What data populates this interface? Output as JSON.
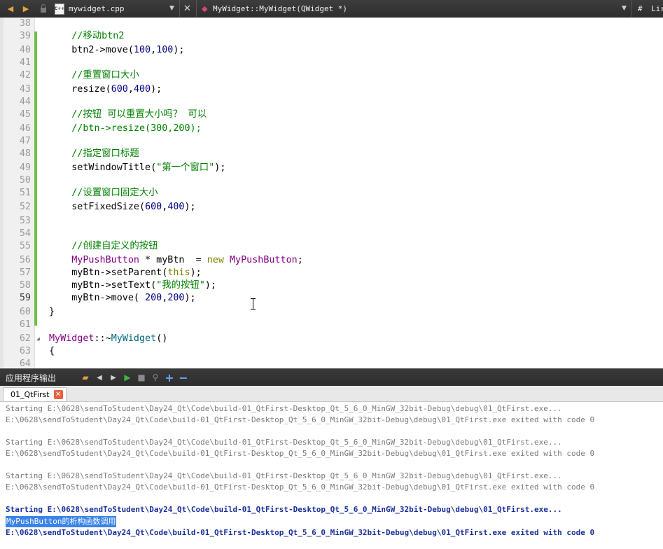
{
  "toolbar": {
    "file_name": "mywidget.cpp",
    "file_icon_text": "C++",
    "function_scope": "MyWidget::MyWidget(QWidget *)",
    "hash_label": "#",
    "lines_label": "Lir"
  },
  "editor": {
    "lines": [
      {
        "num": "38",
        "parts": []
      },
      {
        "num": "39",
        "parts": [
          {
            "t": "    "
          },
          {
            "t": "//移动btn2",
            "c": "com"
          }
        ]
      },
      {
        "num": "40",
        "parts": [
          {
            "t": "    btn2->move("
          },
          {
            "t": "100",
            "c": "num"
          },
          {
            "t": ","
          },
          {
            "t": "100",
            "c": "num"
          },
          {
            "t": ");"
          }
        ]
      },
      {
        "num": "41",
        "parts": []
      },
      {
        "num": "42",
        "parts": [
          {
            "t": "    "
          },
          {
            "t": "//重置窗口大小",
            "c": "com"
          }
        ]
      },
      {
        "num": "43",
        "parts": [
          {
            "t": "    resize("
          },
          {
            "t": "600",
            "c": "num"
          },
          {
            "t": ","
          },
          {
            "t": "400",
            "c": "num"
          },
          {
            "t": ");"
          }
        ]
      },
      {
        "num": "44",
        "parts": []
      },
      {
        "num": "45",
        "parts": [
          {
            "t": "    "
          },
          {
            "t": "//按钮 可以重置大小吗？ 可以",
            "c": "com"
          }
        ]
      },
      {
        "num": "46",
        "parts": [
          {
            "t": "    "
          },
          {
            "t": "//btn->resize(300,200);",
            "c": "com"
          }
        ]
      },
      {
        "num": "47",
        "parts": []
      },
      {
        "num": "48",
        "parts": [
          {
            "t": "    "
          },
          {
            "t": "//指定窗口标题",
            "c": "com"
          }
        ]
      },
      {
        "num": "49",
        "parts": [
          {
            "t": "    setWindowTitle("
          },
          {
            "t": "\"第一个窗口\"",
            "c": "str"
          },
          {
            "t": ");"
          }
        ]
      },
      {
        "num": "50",
        "parts": []
      },
      {
        "num": "51",
        "parts": [
          {
            "t": "    "
          },
          {
            "t": "//设置窗口固定大小",
            "c": "com"
          }
        ]
      },
      {
        "num": "52",
        "parts": [
          {
            "t": "    setFixedSize("
          },
          {
            "t": "600",
            "c": "num"
          },
          {
            "t": ","
          },
          {
            "t": "400",
            "c": "num"
          },
          {
            "t": ");"
          }
        ]
      },
      {
        "num": "53",
        "parts": []
      },
      {
        "num": "54",
        "parts": []
      },
      {
        "num": "55",
        "parts": [
          {
            "t": "    "
          },
          {
            "t": "//创建自定义的按钮",
            "c": "com"
          }
        ]
      },
      {
        "num": "56",
        "parts": [
          {
            "t": "    "
          },
          {
            "t": "MyPushButton",
            "c": "type"
          },
          {
            "t": " * myBtn  = "
          },
          {
            "t": "new",
            "c": "kw"
          },
          {
            "t": " "
          },
          {
            "t": "MyPushButton",
            "c": "type"
          },
          {
            "t": ";"
          }
        ]
      },
      {
        "num": "57",
        "parts": [
          {
            "t": "    myBtn->setParent("
          },
          {
            "t": "this",
            "c": "kw"
          },
          {
            "t": ");"
          }
        ]
      },
      {
        "num": "58",
        "parts": [
          {
            "t": "    myBtn->setText("
          },
          {
            "t": "\"我的按钮\"",
            "c": "str"
          },
          {
            "t": ");"
          }
        ]
      },
      {
        "num": "59",
        "parts": [
          {
            "t": "    myBtn->move( "
          },
          {
            "t": "200",
            "c": "num"
          },
          {
            "t": ","
          },
          {
            "t": "200",
            "c": "num"
          },
          {
            "t": ");"
          }
        ]
      },
      {
        "num": "60",
        "parts": [
          {
            "t": "}"
          }
        ]
      },
      {
        "num": "61",
        "parts": []
      },
      {
        "num": "62",
        "parts": [
          {
            "t": "MyWidget",
            "c": "type"
          },
          {
            "t": "::~"
          },
          {
            "t": "MyWidget",
            "c": "fn"
          },
          {
            "t": "()"
          }
        ],
        "fold": true
      },
      {
        "num": "63",
        "parts": [
          {
            "t": "{"
          }
        ]
      },
      {
        "num": "64",
        "parts": []
      }
    ],
    "current_line": "59"
  },
  "output_pane": {
    "title": "应用程序输出",
    "tab_label": "01_QtFirst",
    "log": [
      {
        "text": "Starting E:\\0628\\sendToStudent\\Day24_Qt\\Code\\build-01_QtFirst-Desktop_Qt_5_6_0_MinGW_32bit-Debug\\debug\\01_QtFirst.exe...",
        "style": "grey"
      },
      {
        "text": "E:\\0628\\sendToStudent\\Day24_Qt\\Code\\build-01_QtFirst-Desktop_Qt_5_6_0_MinGW_32bit-Debug\\debug\\01_QtFirst.exe exited with code 0",
        "style": "grey"
      },
      {
        "text": "",
        "style": "grey"
      },
      {
        "text": "Starting E:\\0628\\sendToStudent\\Day24_Qt\\Code\\build-01_QtFirst-Desktop_Qt_5_6_0_MinGW_32bit-Debug\\debug\\01_QtFirst.exe...",
        "style": "grey"
      },
      {
        "text": "E:\\0628\\sendToStudent\\Day24_Qt\\Code\\build-01_QtFirst-Desktop_Qt_5_6_0_MinGW_32bit-Debug\\debug\\01_QtFirst.exe exited with code 0",
        "style": "grey"
      },
      {
        "text": "",
        "style": "grey"
      },
      {
        "text": "Starting E:\\0628\\sendToStudent\\Day24_Qt\\Code\\build-01_QtFirst-Desktop_Qt_5_6_0_MinGW_32bit-Debug\\debug\\01_QtFirst.exe...",
        "style": "grey"
      },
      {
        "text": "E:\\0628\\sendToStudent\\Day24_Qt\\Code\\build-01_QtFirst-Desktop_Qt_5_6_0_MinGW_32bit-Debug\\debug\\01_QtFirst.exe exited with code 0",
        "style": "grey"
      },
      {
        "text": "",
        "style": "grey"
      },
      {
        "text": "Starting E:\\0628\\sendToStudent\\Day24_Qt\\Code\\build-01_QtFirst-Desktop_Qt_5_6_0_MinGW_32bit-Debug\\debug\\01_QtFirst.exe...",
        "style": "blue"
      },
      {
        "text": "MyPushButton的析构函数调用",
        "style": "sel"
      },
      {
        "text": "E:\\0628\\sendToStudent\\Day24_Qt\\Code\\build-01_QtFirst-Desktop_Qt_5_6_0_MinGW_32bit-Debug\\debug\\01_QtFirst.exe exited with code 0",
        "style": "blue"
      }
    ]
  },
  "colors": {
    "comment": "#008000",
    "number": "#000080",
    "type": "#800080",
    "keyword": "#808000",
    "selection": "#3a83e8"
  }
}
